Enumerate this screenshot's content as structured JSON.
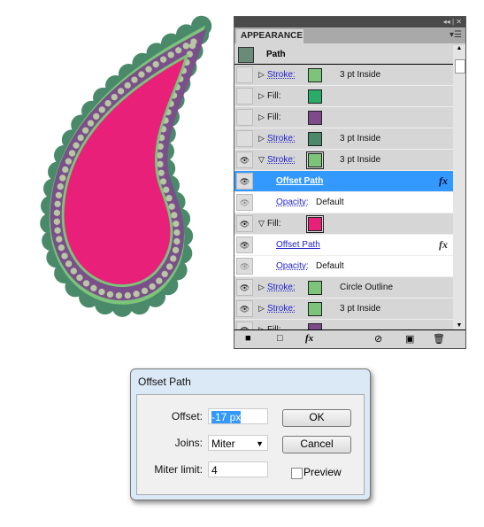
{
  "colors": {
    "scallop": "#4a8a6a",
    "border": "#7cc47a",
    "band": "#7a4f8a",
    "dots": "#b9c6a4",
    "fill": "#e8207a",
    "selection": "#3399ff"
  },
  "panel": {
    "title": "APPEARANCE",
    "collapse_icon": "double-chevron-left-icon",
    "close_icon": "close-icon",
    "menu_icon": "panel-menu-icon",
    "object": "Path",
    "rows": [
      {
        "type": "Stroke:",
        "color": "#7cc47a",
        "value": "3 pt  Inside",
        "visible": false,
        "expanded": false
      },
      {
        "type": "Fill:",
        "color": "#2aac68",
        "value": "",
        "visible": false,
        "expanded": false
      },
      {
        "type": "Fill:",
        "color": "#7d4a8c",
        "value": "",
        "visible": false,
        "expanded": false
      },
      {
        "type": "Stroke:",
        "color": "#4a8a6a",
        "value": "3 pt  Inside",
        "visible": false,
        "expanded": false
      },
      {
        "type": "Stroke:",
        "color": "#7cc47a",
        "value": "3 pt  Inside",
        "visible": true,
        "expanded": true
      },
      {
        "effect": "Offset Path",
        "selected": true
      },
      {
        "opacity_label": "Opacity:",
        "opacity_value": "Default"
      },
      {
        "type": "Fill:",
        "color": "#e8207a",
        "value": "",
        "visible": true,
        "expanded": true
      },
      {
        "effect": "Offset Path",
        "selected": false
      },
      {
        "opacity_label": "Opacity:",
        "opacity_value": "Default"
      },
      {
        "type": "Stroke:",
        "color": "#7cc47a",
        "value": "Circle Outline",
        "visible": true,
        "expanded": false
      },
      {
        "type": "Stroke:",
        "color": "#7cc47a",
        "value": "3 pt  Inside",
        "visible": true,
        "expanded": false
      },
      {
        "type": "Fill:",
        "color": "#7d4a8c",
        "value": "",
        "visible": true,
        "expanded": false
      }
    ],
    "fx_label": "fx"
  },
  "dialog": {
    "title": "Offset Path",
    "offset_label": "Offset:",
    "offset_value": "-17 px",
    "joins_label": "Joins:",
    "joins_value": "Miter",
    "miter_label": "Miter limit:",
    "miter_value": "4",
    "ok": "OK",
    "cancel": "Cancel",
    "preview": "Preview",
    "preview_checked": false
  }
}
